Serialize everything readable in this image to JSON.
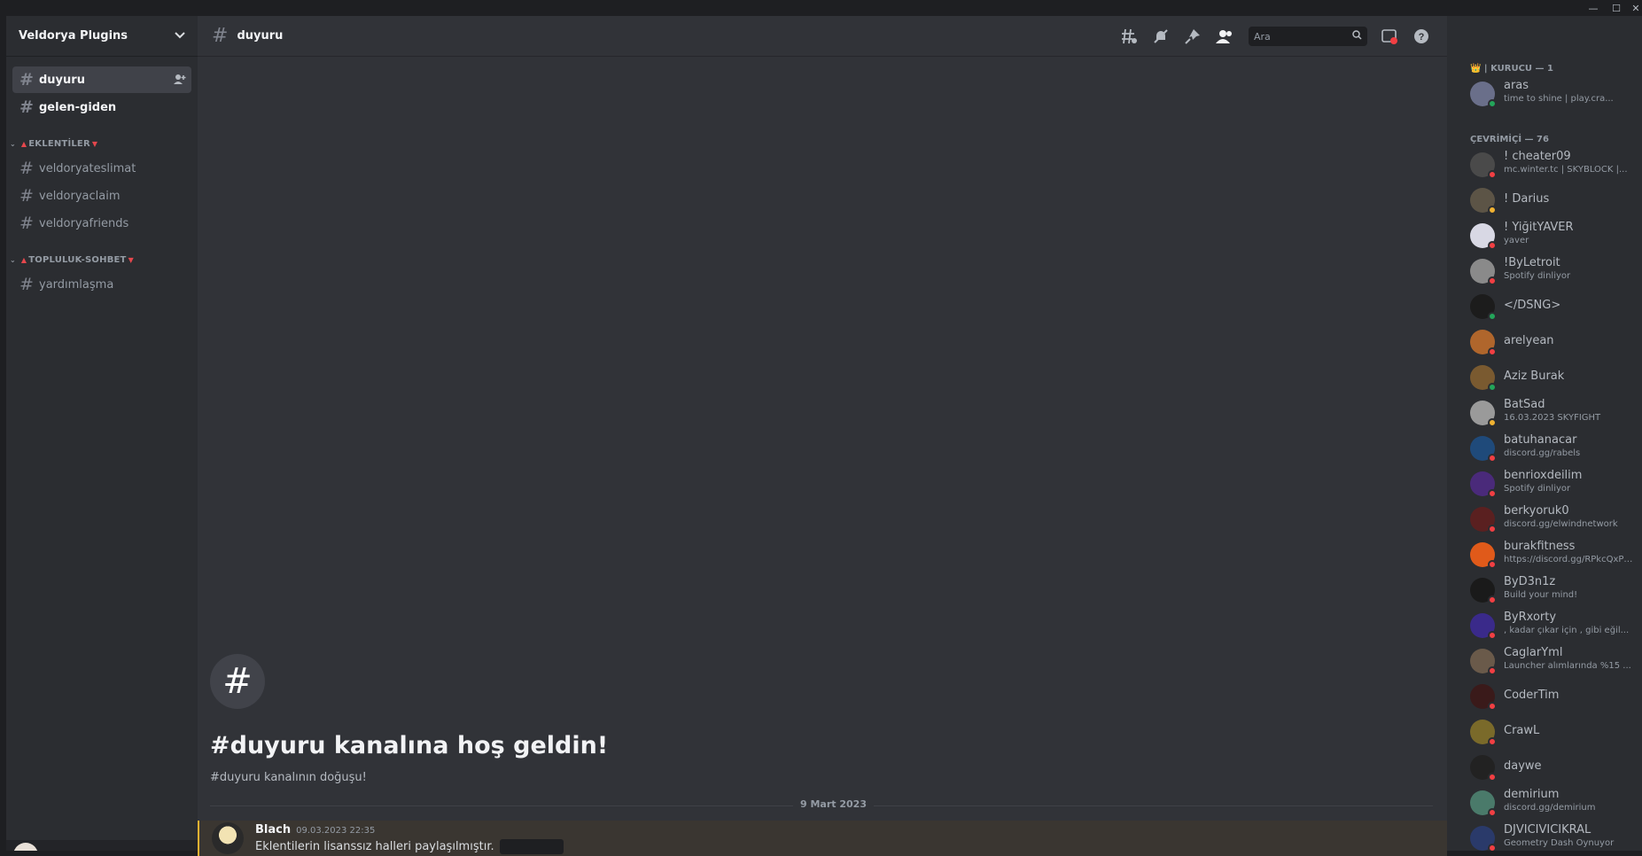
{
  "window": {
    "minimize": "—",
    "maximize": "☐",
    "close": "✕"
  },
  "server": {
    "name": "Veldorya Plugins",
    "dropdown_icon": "chevron-down-icon"
  },
  "channels": {
    "top": [
      {
        "name": "duyuru",
        "state": "active"
      },
      {
        "name": "gelen-giden",
        "state": "unread"
      }
    ],
    "categories": [
      {
        "label": "EKLENTİLER",
        "channels": [
          "veldoryateslimat",
          "veldoryaclaim",
          "veldoryafriends"
        ]
      },
      {
        "label": "TOPLULUK-SOHBET",
        "channels": [
          "yardımlaşma"
        ]
      }
    ]
  },
  "header": {
    "channel": "duyuru",
    "search_placeholder": "Ara"
  },
  "welcome": {
    "title": "#duyuru kanalına hoş geldin!",
    "subtitle": "#duyuru kanalının doğuşu!"
  },
  "divider_date": "9 Mart 2023",
  "message": {
    "author": "Blach",
    "timestamp": "09.03.2023 22:35",
    "text": "Eklentilerin lisanssız halleri paylaşılmıştır."
  },
  "members": {
    "groups": [
      {
        "label": "👑 | KURUCU — 1",
        "members": [
          {
            "name": "aras",
            "activity": "time to shine | play.cra...",
            "status": "#23a55a",
            "avatar": "#6a6f8a"
          }
        ]
      },
      {
        "label": "ÇEVRİMİÇİ — 76",
        "members": [
          {
            "name": "! cheater09",
            "activity": "mc.winter.tc | SKYBLOCK |...",
            "status": "#f23f43",
            "avatar": "#4a4a4a"
          },
          {
            "name": "! Darius",
            "activity": "",
            "status": "#f0b232",
            "avatar": "#5c5446"
          },
          {
            "name": "! YiğitYAVER",
            "activity": "yaver",
            "status": "#f23f43",
            "avatar": "#d8d8e4"
          },
          {
            "name": "!ByLetroit",
            "activity": "Spotify dinliyor",
            "status": "#f23f43",
            "avatar": "#8a8a8a"
          },
          {
            "name": "</DSNG>",
            "activity": "",
            "status": "#23a55a",
            "avatar": "#1c1c1c"
          },
          {
            "name": "arelyean",
            "activity": "",
            "status": "#f23f43",
            "avatar": "#b0662c"
          },
          {
            "name": "Aziz Burak",
            "activity": "",
            "status": "#23a55a",
            "avatar": "#7a5a30"
          },
          {
            "name": "BatSad",
            "activity": "16.03.2023 SKYFIGHT",
            "status": "#f0b232",
            "avatar": "#9a9a9a"
          },
          {
            "name": "batuhanacar",
            "activity": "discord.gg/rabels",
            "status": "#f23f43",
            "avatar": "#1f4a7a"
          },
          {
            "name": "benrioxdeilim",
            "activity": "Spotify dinliyor",
            "status": "#f23f43",
            "avatar": "#4a2a7a"
          },
          {
            "name": "berkyoruk0",
            "activity": "discord.gg/elwindnetwork",
            "status": "#f23f43",
            "avatar": "#5a2020"
          },
          {
            "name": "burakfitness",
            "activity": "https://discord.gg/RPkcQxPZFz",
            "status": "#f23f43",
            "avatar": "#e05a1a"
          },
          {
            "name": "ByD3n1z",
            "activity": "Build your mind!",
            "status": "#f23f43",
            "avatar": "#1a1a1a"
          },
          {
            "name": "ByRxorty",
            "activity": ", kadar çıkar için , gibi eğil...",
            "status": "#f23f43",
            "avatar": "#3a2a8a"
          },
          {
            "name": "CaglarYml",
            "activity": "Launcher alımlarında %15 ...",
            "status": "#f23f43",
            "avatar": "#6a5a4a"
          },
          {
            "name": "CoderTim",
            "activity": "",
            "status": "#f23f43",
            "avatar": "#3a1a1a"
          },
          {
            "name": "CrawL",
            "activity": "",
            "status": "#f23f43",
            "avatar": "#7a6a2a"
          },
          {
            "name": "daywe",
            "activity": "",
            "status": "#f23f43",
            "avatar": "#222222"
          },
          {
            "name": "demirium",
            "activity": "discord.gg/demirium",
            "status": "#f23f43",
            "avatar": "#4a7a6a"
          },
          {
            "name": "DJVICIVICIKRAL",
            "activity": "Geometry Dash Oynuyor",
            "status": "#f23f43",
            "avatar": "#2a3a6a"
          }
        ]
      }
    ]
  }
}
